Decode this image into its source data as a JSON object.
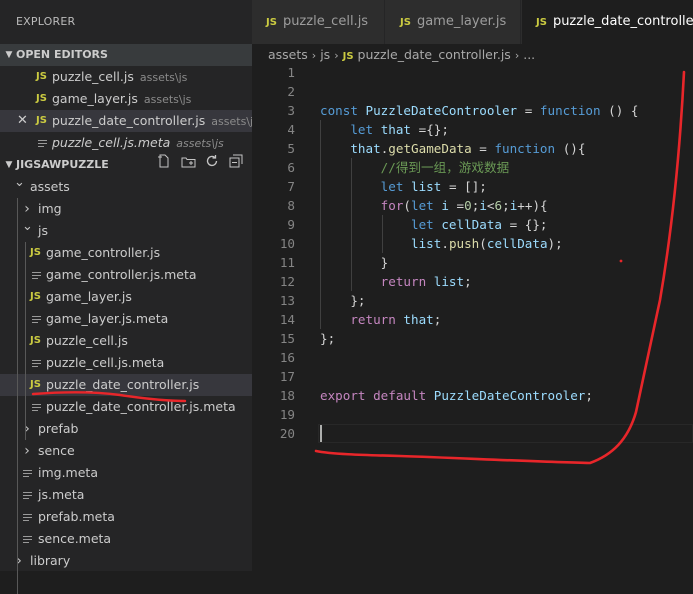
{
  "sidebar": {
    "title": "EXPLORER",
    "open_editors": {
      "header": "OPEN EDITORS",
      "items": [
        {
          "icon": "JS",
          "name": "puzzle_cell.js",
          "path": "assets\\js",
          "italic": false,
          "close": ""
        },
        {
          "icon": "JS",
          "name": "game_layer.js",
          "path": "assets\\js",
          "italic": false,
          "close": ""
        },
        {
          "icon": "JS",
          "name": "puzzle_date_controller.js",
          "path": "assets\\js",
          "italic": false,
          "close": "✕"
        },
        {
          "icon": "meta",
          "name": "puzzle_cell.js.meta",
          "path": "assets\\js",
          "italic": true,
          "close": ""
        }
      ]
    },
    "project": {
      "header": "JIGSAWPUZZLE",
      "tree": [
        {
          "label": "assets",
          "type": "folder-open",
          "depth": 0
        },
        {
          "label": "img",
          "type": "folder",
          "depth": 1
        },
        {
          "label": "js",
          "type": "folder-open",
          "depth": 1
        },
        {
          "label": "game_controller.js",
          "type": "js",
          "depth": 2
        },
        {
          "label": "game_controller.js.meta",
          "type": "meta",
          "depth": 2
        },
        {
          "label": "game_layer.js",
          "type": "js",
          "depth": 2
        },
        {
          "label": "game_layer.js.meta",
          "type": "meta",
          "depth": 2
        },
        {
          "label": "puzzle_cell.js",
          "type": "js",
          "depth": 2
        },
        {
          "label": "puzzle_cell.js.meta",
          "type": "meta",
          "depth": 2
        },
        {
          "label": "puzzle_date_controller.js",
          "type": "js",
          "depth": 2,
          "selected": true
        },
        {
          "label": "puzzle_date_controller.js.meta",
          "type": "meta",
          "depth": 2
        },
        {
          "label": "prefab",
          "type": "folder",
          "depth": 1
        },
        {
          "label": "sence",
          "type": "folder",
          "depth": 1
        },
        {
          "label": "img.meta",
          "type": "meta",
          "depth": 1
        },
        {
          "label": "js.meta",
          "type": "meta",
          "depth": 1
        },
        {
          "label": "prefab.meta",
          "type": "meta",
          "depth": 1
        },
        {
          "label": "sence.meta",
          "type": "meta",
          "depth": 1
        },
        {
          "label": "library",
          "type": "folder",
          "depth": 0
        }
      ]
    }
  },
  "tabs": [
    {
      "icon": "JS",
      "label": "puzzle_cell.js",
      "active": false
    },
    {
      "icon": "JS",
      "label": "game_layer.js",
      "active": false
    },
    {
      "icon": "JS",
      "label": "puzzle_date_controller.js",
      "active": true
    }
  ],
  "breadcrumb": {
    "parts": [
      "assets",
      "js"
    ],
    "file_icon": "JS",
    "file": "puzzle_date_controller.js",
    "ellipsis": "..."
  },
  "editor": {
    "lines": [
      {
        "n": "1",
        "tokens": []
      },
      {
        "n": "2",
        "tokens": []
      },
      {
        "n": "3",
        "tokens": [
          [
            "k",
            "const "
          ],
          [
            "v",
            "PuzzleDateControoler"
          ],
          [
            "p",
            " = "
          ],
          [
            "k",
            "function"
          ],
          [
            "p",
            " () {"
          ]
        ]
      },
      {
        "n": "4",
        "tokens": [
          [
            "p",
            "    "
          ],
          [
            "k",
            "let "
          ],
          [
            "v",
            "that"
          ],
          [
            "p",
            " ={};"
          ]
        ]
      },
      {
        "n": "5",
        "tokens": [
          [
            "p",
            "    "
          ],
          [
            "v",
            "that"
          ],
          [
            "p",
            "."
          ],
          [
            "f",
            "getGameData"
          ],
          [
            "p",
            " = "
          ],
          [
            "k",
            "function"
          ],
          [
            "p",
            " (){"
          ]
        ]
      },
      {
        "n": "6",
        "tokens": [
          [
            "p",
            "        "
          ],
          [
            "cm",
            "//得到一组，游戏数据"
          ]
        ]
      },
      {
        "n": "7",
        "tokens": [
          [
            "p",
            "        "
          ],
          [
            "k",
            "let "
          ],
          [
            "v",
            "list"
          ],
          [
            "p",
            " = [];"
          ]
        ]
      },
      {
        "n": "8",
        "tokens": [
          [
            "p",
            "        "
          ],
          [
            "c",
            "for"
          ],
          [
            "p",
            "("
          ],
          [
            "k",
            "let "
          ],
          [
            "v",
            "i"
          ],
          [
            "p",
            " ="
          ],
          [
            "n",
            "0"
          ],
          [
            "p",
            ";"
          ],
          [
            "v",
            "i"
          ],
          [
            "p",
            "<"
          ],
          [
            "n",
            "6"
          ],
          [
            "p",
            ";"
          ],
          [
            "v",
            "i"
          ],
          [
            "p",
            "++){"
          ]
        ]
      },
      {
        "n": "9",
        "tokens": [
          [
            "p",
            "            "
          ],
          [
            "k",
            "let "
          ],
          [
            "v",
            "cellData"
          ],
          [
            "p",
            " = {};"
          ]
        ]
      },
      {
        "n": "10",
        "tokens": [
          [
            "p",
            "            "
          ],
          [
            "v",
            "list"
          ],
          [
            "p",
            "."
          ],
          [
            "f",
            "push"
          ],
          [
            "p",
            "("
          ],
          [
            "v",
            "cellData"
          ],
          [
            "p",
            ");"
          ]
        ]
      },
      {
        "n": "11",
        "tokens": [
          [
            "p",
            "        }"
          ]
        ]
      },
      {
        "n": "12",
        "tokens": [
          [
            "p",
            "        "
          ],
          [
            "c",
            "return "
          ],
          [
            "v",
            "list"
          ],
          [
            "p",
            ";"
          ]
        ]
      },
      {
        "n": "13",
        "tokens": [
          [
            "p",
            "    };"
          ]
        ]
      },
      {
        "n": "14",
        "tokens": [
          [
            "p",
            "    "
          ],
          [
            "c",
            "return "
          ],
          [
            "v",
            "that"
          ],
          [
            "p",
            ";"
          ]
        ]
      },
      {
        "n": "15",
        "tokens": [
          [
            "p",
            "};"
          ]
        ]
      },
      {
        "n": "16",
        "tokens": []
      },
      {
        "n": "17",
        "tokens": []
      },
      {
        "n": "18",
        "tokens": [
          [
            "c",
            "export "
          ],
          [
            "c",
            "default "
          ],
          [
            "v",
            "PuzzleDateControoler"
          ],
          [
            "p",
            ";"
          ]
        ]
      },
      {
        "n": "19",
        "tokens": []
      },
      {
        "n": "20",
        "tokens": []
      }
    ],
    "current_line": 20
  },
  "icons": {
    "new_file": "new-file-icon",
    "new_folder": "new-folder-icon",
    "refresh": "refresh-icon",
    "collapse": "collapse-all-icon"
  },
  "colors": {
    "annotation_red": "#e8262a",
    "js_badge": "#cbcb41"
  }
}
